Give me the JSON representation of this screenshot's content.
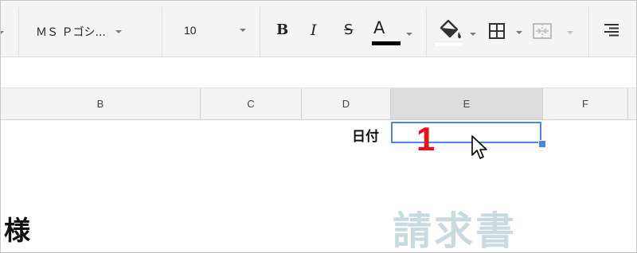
{
  "toolbar": {
    "font_name": "ＭＳ Ｐゴシ...",
    "font_size": "10",
    "bold_label": "B",
    "italic_label": "I",
    "strike_label": "S",
    "text_color_label": "A"
  },
  "columns": [
    "B",
    "C",
    "D",
    "E",
    "F"
  ],
  "selected_column": "E",
  "cells": {
    "date_label": "日付",
    "title_watermark": "請求書",
    "customer_suffix": "様"
  },
  "annotation": {
    "step_number": "1"
  },
  "colors": {
    "selection": "#4a86e8",
    "annotation": "#e8101a",
    "watermark": "#c9dbe0"
  }
}
